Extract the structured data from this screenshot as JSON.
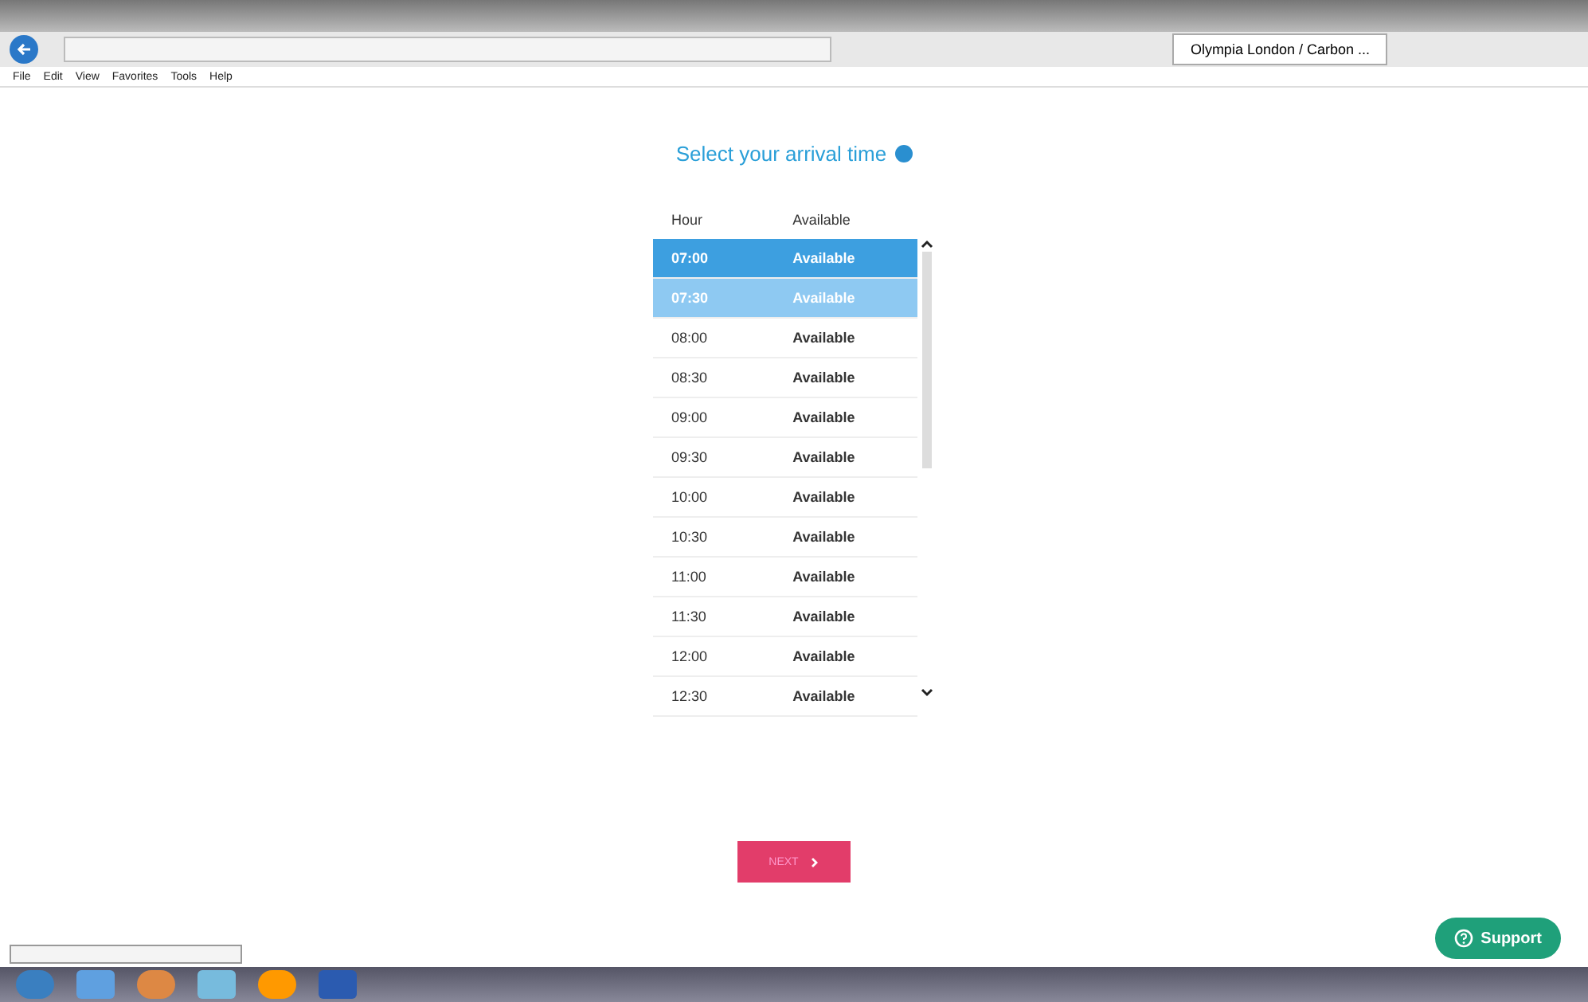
{
  "browser": {
    "tabs": [
      {
        "label": "Olympia London / Carbon ...",
        "selected": true
      }
    ],
    "menu": [
      "File",
      "Edit",
      "View",
      "Favorites",
      "Tools",
      "Help"
    ]
  },
  "page": {
    "title": "Select your arrival time",
    "columns": [
      "Hour",
      "Available"
    ],
    "rows": [
      {
        "hour": "07:00",
        "status": "Available",
        "selected": true,
        "hovered": false
      },
      {
        "hour": "07:30",
        "status": "Available",
        "selected": false,
        "hovered": true
      },
      {
        "hour": "08:00",
        "status": "Available",
        "selected": false,
        "hovered": false
      },
      {
        "hour": "08:30",
        "status": "Available",
        "selected": false,
        "hovered": false
      },
      {
        "hour": "09:00",
        "status": "Available",
        "selected": false,
        "hovered": false
      },
      {
        "hour": "09:30",
        "status": "Available",
        "selected": false,
        "hovered": false
      },
      {
        "hour": "10:00",
        "status": "Available",
        "selected": false,
        "hovered": false
      },
      {
        "hour": "10:30",
        "status": "Available",
        "selected": false,
        "hovered": false
      },
      {
        "hour": "11:00",
        "status": "Available",
        "selected": false,
        "hovered": false
      },
      {
        "hour": "11:30",
        "status": "Available",
        "selected": false,
        "hovered": false
      },
      {
        "hour": "12:00",
        "status": "Available",
        "selected": false,
        "hovered": false
      },
      {
        "hour": "12:30",
        "status": "Available",
        "selected": false,
        "hovered": false
      }
    ],
    "next_button": "NEXT",
    "support_button": "Support"
  }
}
